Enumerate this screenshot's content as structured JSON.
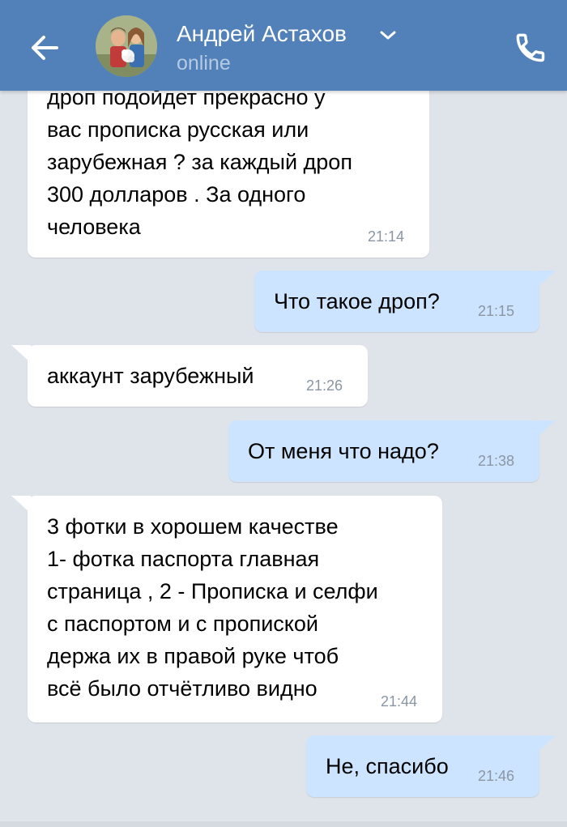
{
  "header": {
    "contact_name": "Андрей Астахов",
    "status": "online",
    "icons": {
      "back": "back-arrow-icon",
      "chevron": "chevron-down-icon",
      "call": "phone-icon"
    },
    "colors": {
      "bar": "#5181b8",
      "status_text": "#b6cae4"
    }
  },
  "messages": [
    {
      "direction": "incoming",
      "lines": [
        "дроп подойдет прекрасно у",
        "вас прописка русская или",
        "зарубежная ? за каждый дроп",
        "300 долларов . За одного",
        "человека"
      ],
      "time": "21:14"
    },
    {
      "direction": "outgoing",
      "lines": [
        "Что такое дроп?"
      ],
      "time": "21:15"
    },
    {
      "direction": "incoming",
      "lines": [
        "аккаунт зарубежный"
      ],
      "time": "21:26"
    },
    {
      "direction": "outgoing",
      "lines": [
        "От меня что надо?"
      ],
      "time": "21:38"
    },
    {
      "direction": "incoming",
      "lines": [
        "3 фотки в хорошем качестве",
        "1- фотка паспорта главная",
        "страница , 2 - Прописка и селфи",
        "с паспортом и с пропиской",
        "держа их в правой руке чтоб",
        "всё было отчётливо видно"
      ],
      "time": "21:44"
    },
    {
      "direction": "outgoing",
      "lines": [
        "Не, спасибо"
      ],
      "time": "21:46"
    }
  ],
  "colors": {
    "background": "#dfe4ea",
    "incoming_bubble": "#ffffff",
    "outgoing_bubble": "#cce4ff",
    "time_text": "#8a96a3"
  }
}
